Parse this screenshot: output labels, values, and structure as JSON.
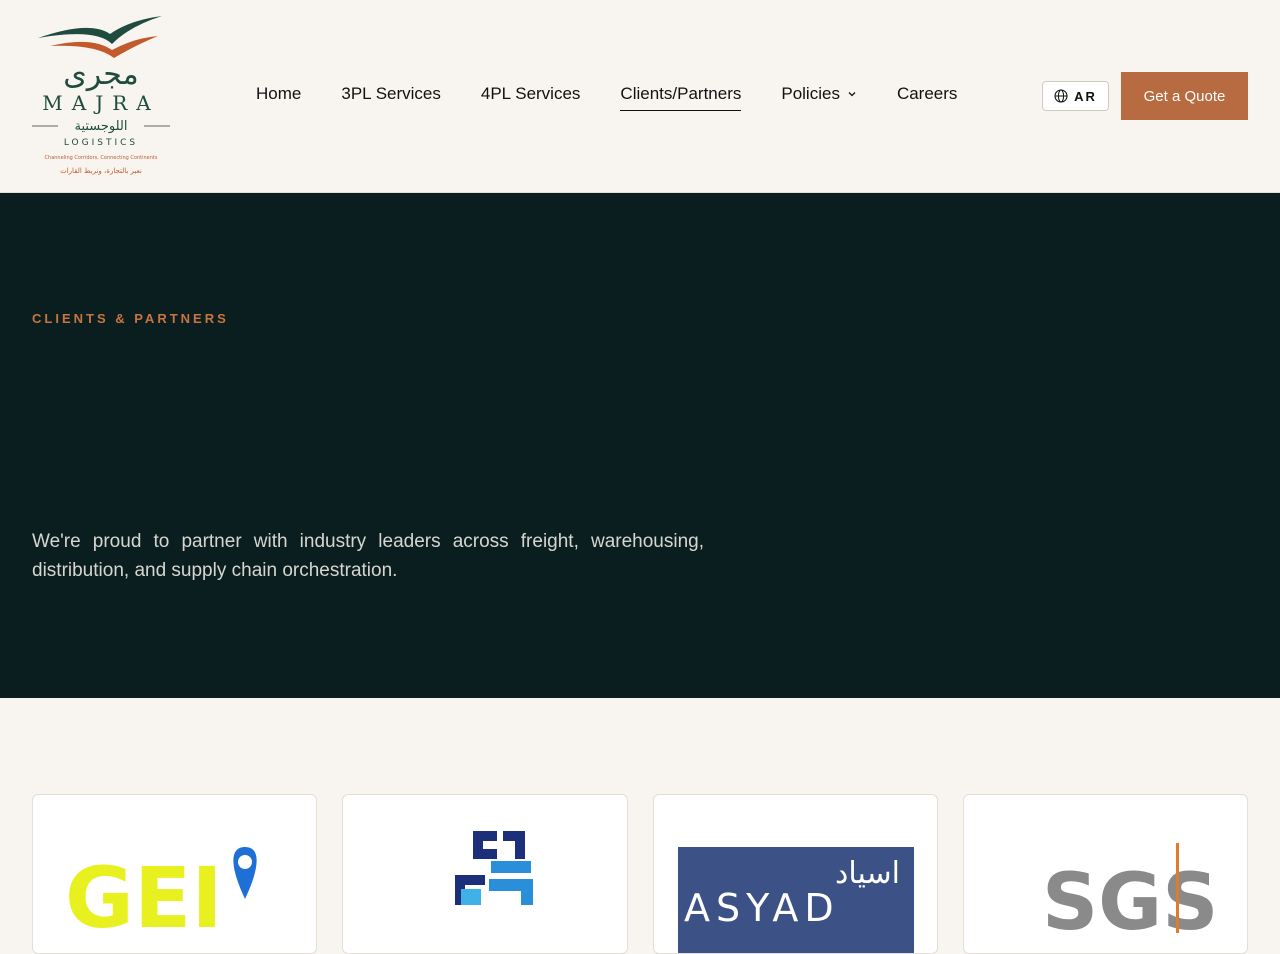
{
  "header": {
    "logo": {
      "arabic_name": "مجرى",
      "name": "MAJRA",
      "arabic_sub": "اللوجستية",
      "sub": "LOGISTICS",
      "tagline_en": "Channeling Corridors, Connecting Continents",
      "tagline_ar": "نعبر بالتجارة، ونربط القارات"
    },
    "nav": [
      {
        "label": "Home"
      },
      {
        "label": "3PL Services"
      },
      {
        "label": "4PL Services"
      },
      {
        "label": "Clients/Partners"
      },
      {
        "label": "Policies"
      },
      {
        "label": "Careers"
      }
    ],
    "lang_label": "AR",
    "quote_label": "Get a Quote"
  },
  "hero": {
    "eyebrow": "CLIENTS & PARTNERS",
    "text": "We're proud to partner with industry leaders across freight, warehousing, distribution, and supply chain orchestration."
  },
  "partners": [
    {
      "logo_text": "GEI",
      "icon": "location-pin-icon"
    },
    {
      "logo_text": "",
      "icon": "mhd-mark-icon"
    },
    {
      "logo_text": "ASYAD",
      "logo_text_ar": "اسياد"
    },
    {
      "logo_text": "SGS"
    }
  ],
  "colors": {
    "accent": "#b86a40",
    "hero_bg": "#0a1e20",
    "page_bg": "#f8f5f0",
    "eyebrow": "#c9743f"
  }
}
